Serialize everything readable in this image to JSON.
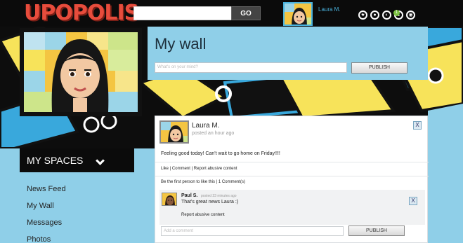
{
  "header": {
    "logo": "UPOPOLIS",
    "go_label": "GO",
    "username": "Laura M."
  },
  "wall": {
    "title": "My wall",
    "placeholder": "What's on your mind?",
    "publish_label": "PUBLISH"
  },
  "nav": {
    "myspaces_label": "MY SPACES",
    "items": [
      "News Feed",
      "My Wall",
      "Messages",
      "Photos"
    ]
  },
  "post": {
    "author": "Laura M.",
    "time": "posted an hour ago",
    "text": "Feeling good today! Can't wait to go home on Friday!!!!",
    "actions": "Like | Comment | Report abusive content",
    "likes": "Be the first person to like this | 1 Comment(s)",
    "close_label": "X",
    "comment": {
      "author": "Paul S.",
      "time": "posted 23 minutes ago",
      "text": "That's great news Laura :)",
      "report": "Report abusive content",
      "close_label": "X"
    },
    "add_comment_placeholder": "Add a comment",
    "publish_label": "PUBLISH"
  },
  "notification_count": "1",
  "colors": {
    "topbar": "#0b0b0b",
    "accent": "#4ab3de",
    "page_bg": "#8fcfe8"
  }
}
